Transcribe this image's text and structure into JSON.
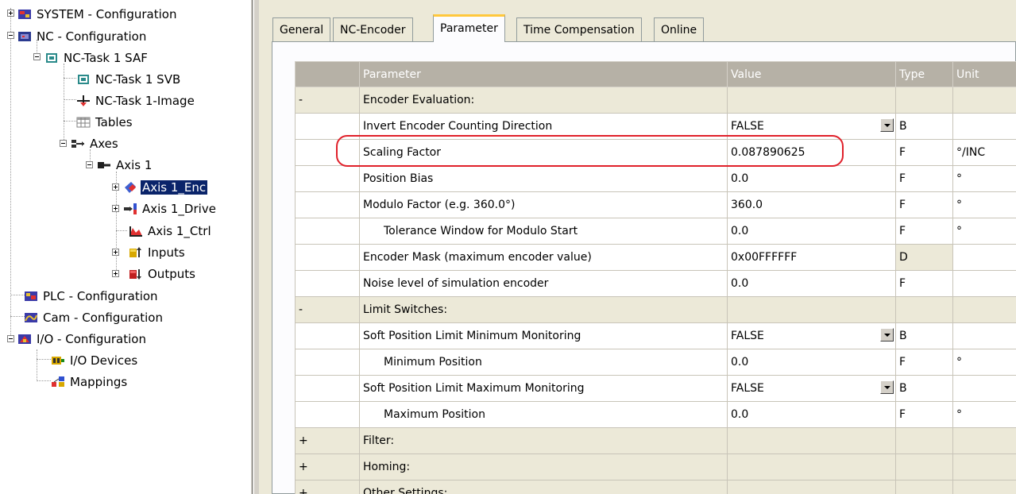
{
  "tree": {
    "items": [
      {
        "label": "SYSTEM - Configuration",
        "icon": "system-config-icon"
      },
      {
        "label": "NC - Configuration",
        "icon": "nc-config-icon"
      },
      {
        "label": "NC-Task 1 SAF",
        "icon": "task-icon"
      },
      {
        "label": "NC-Task 1 SVB",
        "icon": "task-icon"
      },
      {
        "label": "NC-Task 1-Image",
        "icon": "image-icon"
      },
      {
        "label": "Tables",
        "icon": "table-icon"
      },
      {
        "label": "Axes",
        "icon": "axes-icon"
      },
      {
        "label": "Axis 1",
        "icon": "axis-icon"
      },
      {
        "label": "Axis 1_Enc",
        "icon": "encoder-icon"
      },
      {
        "label": "Axis 1_Drive",
        "icon": "drive-icon"
      },
      {
        "label": "Axis 1_Ctrl",
        "icon": "controller-icon"
      },
      {
        "label": "Inputs",
        "icon": "inputs-icon"
      },
      {
        "label": "Outputs",
        "icon": "outputs-icon"
      },
      {
        "label": "PLC - Configuration",
        "icon": "plc-config-icon"
      },
      {
        "label": "Cam - Configuration",
        "icon": "cam-config-icon"
      },
      {
        "label": "I/O - Configuration",
        "icon": "io-config-icon"
      },
      {
        "label": "I/O Devices",
        "icon": "io-devices-icon"
      },
      {
        "label": "Mappings",
        "icon": "mappings-icon"
      }
    ],
    "selected": "Axis 1_Enc"
  },
  "tabs": [
    {
      "label": "General"
    },
    {
      "label": "NC-Encoder"
    },
    {
      "label": "Parameter"
    },
    {
      "label": "Time Compensation"
    },
    {
      "label": "Online"
    }
  ],
  "active_tab": "Parameter",
  "grid": {
    "headers": {
      "col0": "",
      "parameter": "Parameter",
      "value": "Value",
      "type": "Type",
      "unit": "Unit"
    },
    "rows": [
      {
        "kind": "group",
        "toggle": "-",
        "parameter": "Encoder Evaluation:",
        "value": "",
        "type": "",
        "unit": ""
      },
      {
        "kind": "param",
        "toggle": "",
        "parameter": "Invert Encoder Counting Direction",
        "value": "FALSE",
        "dropdown": true,
        "type": "B",
        "unit": ""
      },
      {
        "kind": "param",
        "toggle": "",
        "parameter": "Scaling Factor",
        "value": "0.087890625",
        "type": "F",
        "unit": "°/INC"
      },
      {
        "kind": "param",
        "toggle": "",
        "parameter": "Position Bias",
        "value": "0.0",
        "type": "F",
        "unit": "°"
      },
      {
        "kind": "param",
        "toggle": "",
        "parameter": "Modulo Factor (e.g. 360.0°)",
        "value": "360.0",
        "type": "F",
        "unit": "°"
      },
      {
        "kind": "param",
        "toggle": "",
        "parameter": "Tolerance Window for Modulo Start",
        "indent": true,
        "value": "0.0",
        "type": "F",
        "unit": "°"
      },
      {
        "kind": "param",
        "toggle": "",
        "parameter": "Encoder Mask (maximum encoder value)",
        "value": "0x00FFFFFF",
        "type": "D",
        "unit": ""
      },
      {
        "kind": "param",
        "toggle": "",
        "parameter": "Noise level of simulation encoder",
        "value": "0.0",
        "type": "F",
        "unit": ""
      },
      {
        "kind": "group",
        "toggle": "-",
        "parameter": "Limit Switches:",
        "value": "",
        "type": "",
        "unit": ""
      },
      {
        "kind": "param",
        "toggle": "",
        "parameter": "Soft Position Limit Minimum Monitoring",
        "value": "FALSE",
        "dropdown": true,
        "type": "B",
        "unit": ""
      },
      {
        "kind": "param",
        "toggle": "",
        "parameter": "Minimum Position",
        "indent": true,
        "value": "0.0",
        "type": "F",
        "unit": "°"
      },
      {
        "kind": "param",
        "toggle": "",
        "parameter": "Soft Position Limit Maximum Monitoring",
        "value": "FALSE",
        "dropdown": true,
        "type": "B",
        "unit": ""
      },
      {
        "kind": "param",
        "toggle": "",
        "parameter": "Maximum Position",
        "indent": true,
        "value": "0.0",
        "type": "F",
        "unit": "°"
      },
      {
        "kind": "group",
        "toggle": "+",
        "parameter": "Filter:",
        "value": "",
        "type": "",
        "unit": ""
      },
      {
        "kind": "group",
        "toggle": "+",
        "parameter": "Homing:",
        "value": "",
        "type": "",
        "unit": ""
      },
      {
        "kind": "group",
        "toggle": "+",
        "parameter": "Other Settings:",
        "value": "",
        "type": "",
        "unit": ""
      }
    ]
  },
  "colors": {
    "selection": "#0a246a",
    "header": "#b6b1a6",
    "highlight": "#e0202a",
    "tab_accent": "#ffc83c"
  }
}
